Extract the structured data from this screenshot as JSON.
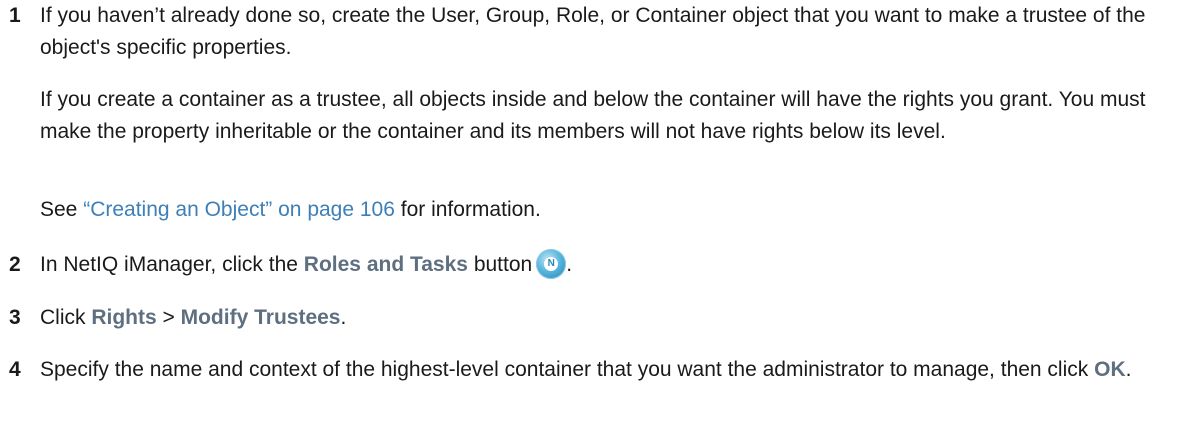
{
  "steps": [
    {
      "number": "1",
      "text_a": "If you haven’t already done so, create the User, Group, Role, or Container object that you want to make a trustee of the object's specific properties.",
      "text_b": "If you create a container as a trustee, all objects inside and below the container will have the rights you grant. You must make the property inheritable or the container and its members will not have rights below its level.",
      "see_prefix": "See ",
      "see_link": "“Creating an Object” on page 106",
      "see_suffix": " for information."
    },
    {
      "number": "2",
      "prefix": "In NetIQ iManager, click the ",
      "ui_label": "Roles and Tasks",
      "suffix": " button",
      "icon": "roles-and-tasks-icon",
      "icon_glyph": "N",
      "end": "."
    },
    {
      "number": "3",
      "prefix": "Click ",
      "ui_1": "Rights",
      "sep": " > ",
      "ui_2": "Modify Trustees",
      "end": "."
    },
    {
      "number": "4",
      "prefix": "Specify the name and context of the highest-level container that you want the administrator to manage, then click ",
      "ui_label": "OK",
      "end": "."
    }
  ]
}
